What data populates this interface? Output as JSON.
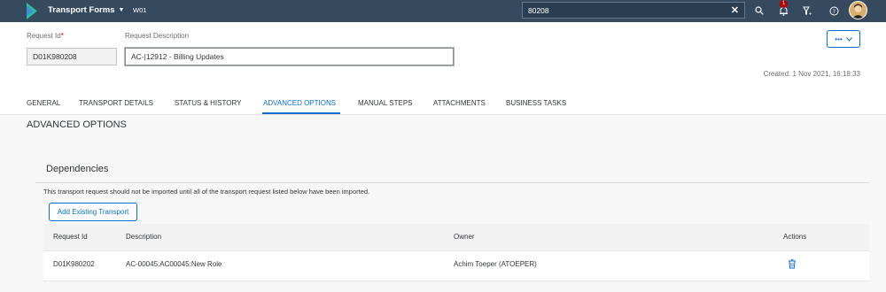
{
  "shell": {
    "app_title": "Transport Forms",
    "system_id": "W01",
    "search_value": "80208",
    "notification_count": "1",
    "icons": [
      "search-icon",
      "bell-icon",
      "filter-icon",
      "help-icon"
    ]
  },
  "header": {
    "request_id_label": "Request Id",
    "request_id_required": "*",
    "request_id_value": "D01K980208",
    "description_label": "Request Description",
    "description_value": "AC-|12912 - Billing Updates",
    "more_button": "•••",
    "created": "Created: 1 Nov 2021, 16:18:33"
  },
  "tabs": [
    {
      "label": "GENERAL"
    },
    {
      "label": "TRANSPORT DETAILS"
    },
    {
      "label": "STATUS & HISTORY"
    },
    {
      "label": "ADVANCED OPTIONS",
      "active": true
    },
    {
      "label": "MANUAL STEPS"
    },
    {
      "label": "ATTACHMENTS"
    },
    {
      "label": "BUSINESS TASKS"
    }
  ],
  "content": {
    "section_title": "ADVANCED OPTIONS",
    "panel_title": "Dependencies",
    "info_text": "This transport request should not be imported until all of the transport request listed below have been imported.",
    "add_button": "Add Existing Transport",
    "table": {
      "columns": [
        "Request Id",
        "Description",
        "Owner",
        "Actions"
      ],
      "rows": [
        {
          "request_id": "D01K980202",
          "description": "AC-00045:AC00045:New Role",
          "owner": "Achim Toeper (ATOEPER)",
          "action_icon": "delete-icon"
        }
      ]
    }
  },
  "colors": {
    "shell_bg": "#354a5f",
    "accent": "#0a6ed1",
    "badge": "#bb0000"
  }
}
